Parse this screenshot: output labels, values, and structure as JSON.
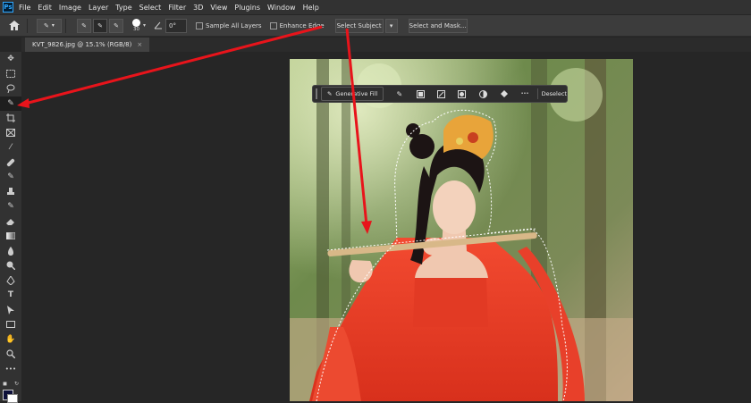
{
  "app": {
    "logo_text": "Ps"
  },
  "menu": [
    "File",
    "Edit",
    "Image",
    "Layer",
    "Type",
    "Select",
    "Filter",
    "3D",
    "View",
    "Plugins",
    "Window",
    "Help"
  ],
  "options_bar": {
    "brush_size": "30",
    "angle": "0°",
    "sample_all_layers": "Sample All Layers",
    "enhance_edge": "Enhance Edge",
    "select_subject": "Select Subject",
    "select_and_mask": "Select and Mask..."
  },
  "document_tab": {
    "title": "KVT_9826.jpg @ 15.1% (RGB/8)",
    "close": "×"
  },
  "context_bar": {
    "generative_fill": "Generative Fill",
    "deselect": "Deselect",
    "more": "•••"
  },
  "colors": {
    "annotation_arrow": "#e8141b",
    "foreground_swatch": "#0d0f3a"
  }
}
